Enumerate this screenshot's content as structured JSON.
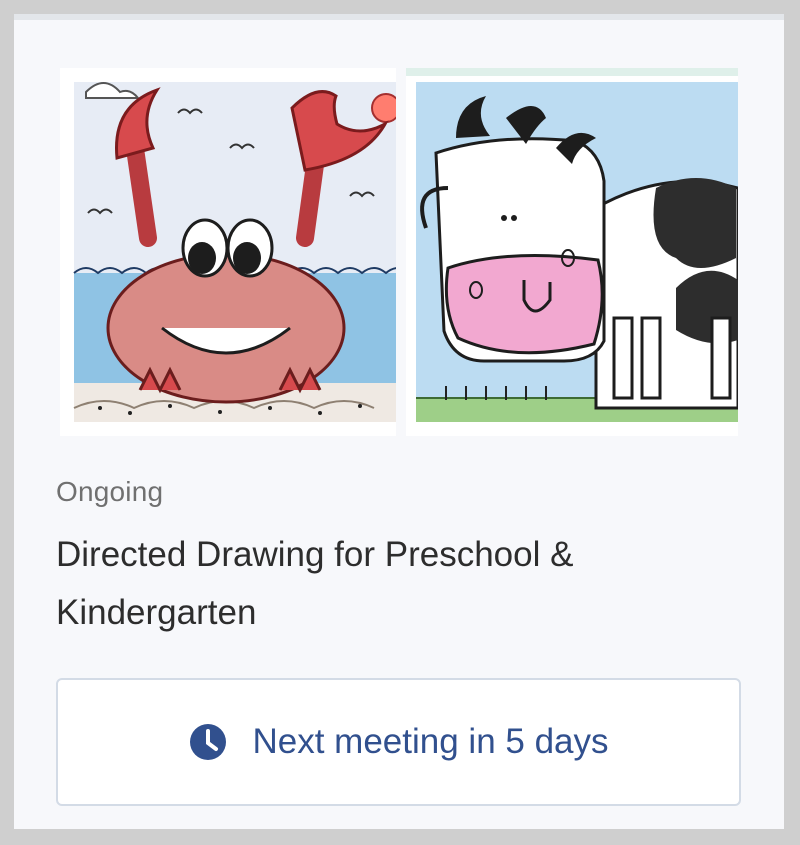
{
  "card": {
    "status": "Ongoing",
    "title": "Directed Drawing for Preschool & Kindergarten",
    "images": [
      {
        "name": "crab drawing"
      },
      {
        "name": "cow drawing"
      }
    ],
    "meeting_button": {
      "icon": "clock-icon",
      "label": "Next meeting in 5 days"
    }
  },
  "colors": {
    "accent": "#31508e",
    "status_text": "#707070",
    "title_text": "#2d2d2d",
    "button_border": "#d3dbe6"
  }
}
